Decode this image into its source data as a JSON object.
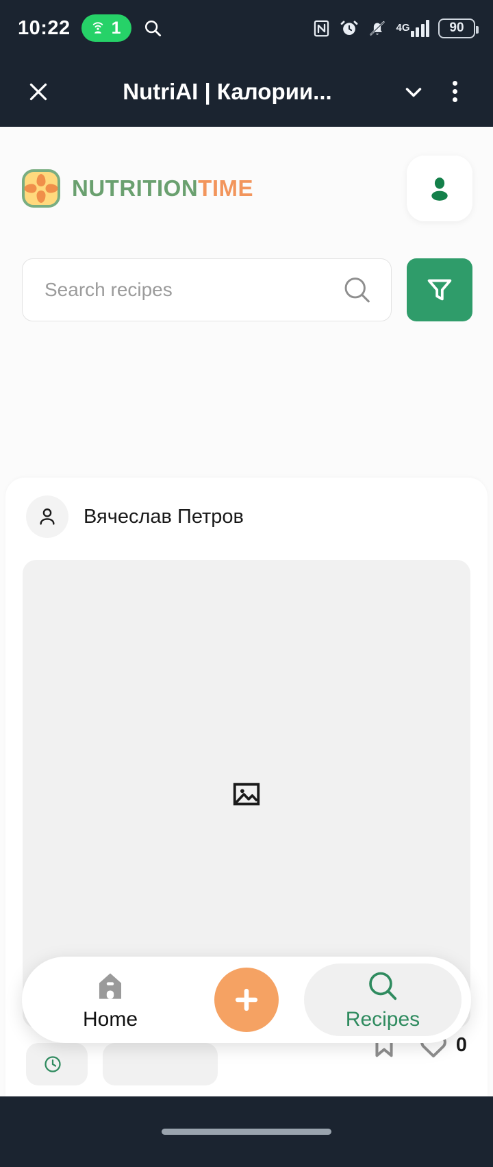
{
  "status_bar": {
    "time": "10:22",
    "hotspot_count": "1",
    "network_type": "4G",
    "battery_level": "90",
    "icons": [
      "wifi-hotspot-icon",
      "search-icon",
      "nfc-icon",
      "alarm-icon",
      "bell-muted-icon",
      "signal-icon",
      "battery-icon"
    ]
  },
  "app_bar": {
    "title": "NutriAI | Калории...",
    "close_label": "✕",
    "icons": [
      "close-icon",
      "chevron-down-icon",
      "overflow-menu-icon"
    ]
  },
  "header": {
    "brand_primary": "NUTRITION",
    "brand_secondary": "TIME",
    "profile_icon": "person-filled-icon"
  },
  "search": {
    "placeholder": "Search recipes",
    "value": "",
    "search_icon": "search-icon",
    "filter_icon": "funnel-icon",
    "filter_color": "#2f9c6a"
  },
  "feed": {
    "post": {
      "author": "Вячеслав Петров",
      "avatar_icon": "person-outline-icon",
      "image_placeholder_icon": "broken-image-icon",
      "chips": [
        {
          "icon": "clock-icon",
          "label": ""
        },
        {
          "icon": "",
          "label": ""
        }
      ],
      "like_count": "0",
      "like_icon": "heart-outline-icon",
      "bookmark_icon": "bookmark-outline-icon"
    }
  },
  "bottom_nav": {
    "items": [
      {
        "label": "Home",
        "icon": "home-icon",
        "active": false
      },
      {
        "label": "Recipes",
        "icon": "search-icon",
        "active": true
      }
    ],
    "fab_label": "+",
    "fab_icon": "plus-icon",
    "fab_color": "#f5a263",
    "active_color": "#2f8b5f"
  },
  "colors": {
    "system_bar": "#1b2430",
    "brand_green": "#6aa06f",
    "brand_orange": "#f2955c",
    "accent_green": "#2f9c6a"
  }
}
